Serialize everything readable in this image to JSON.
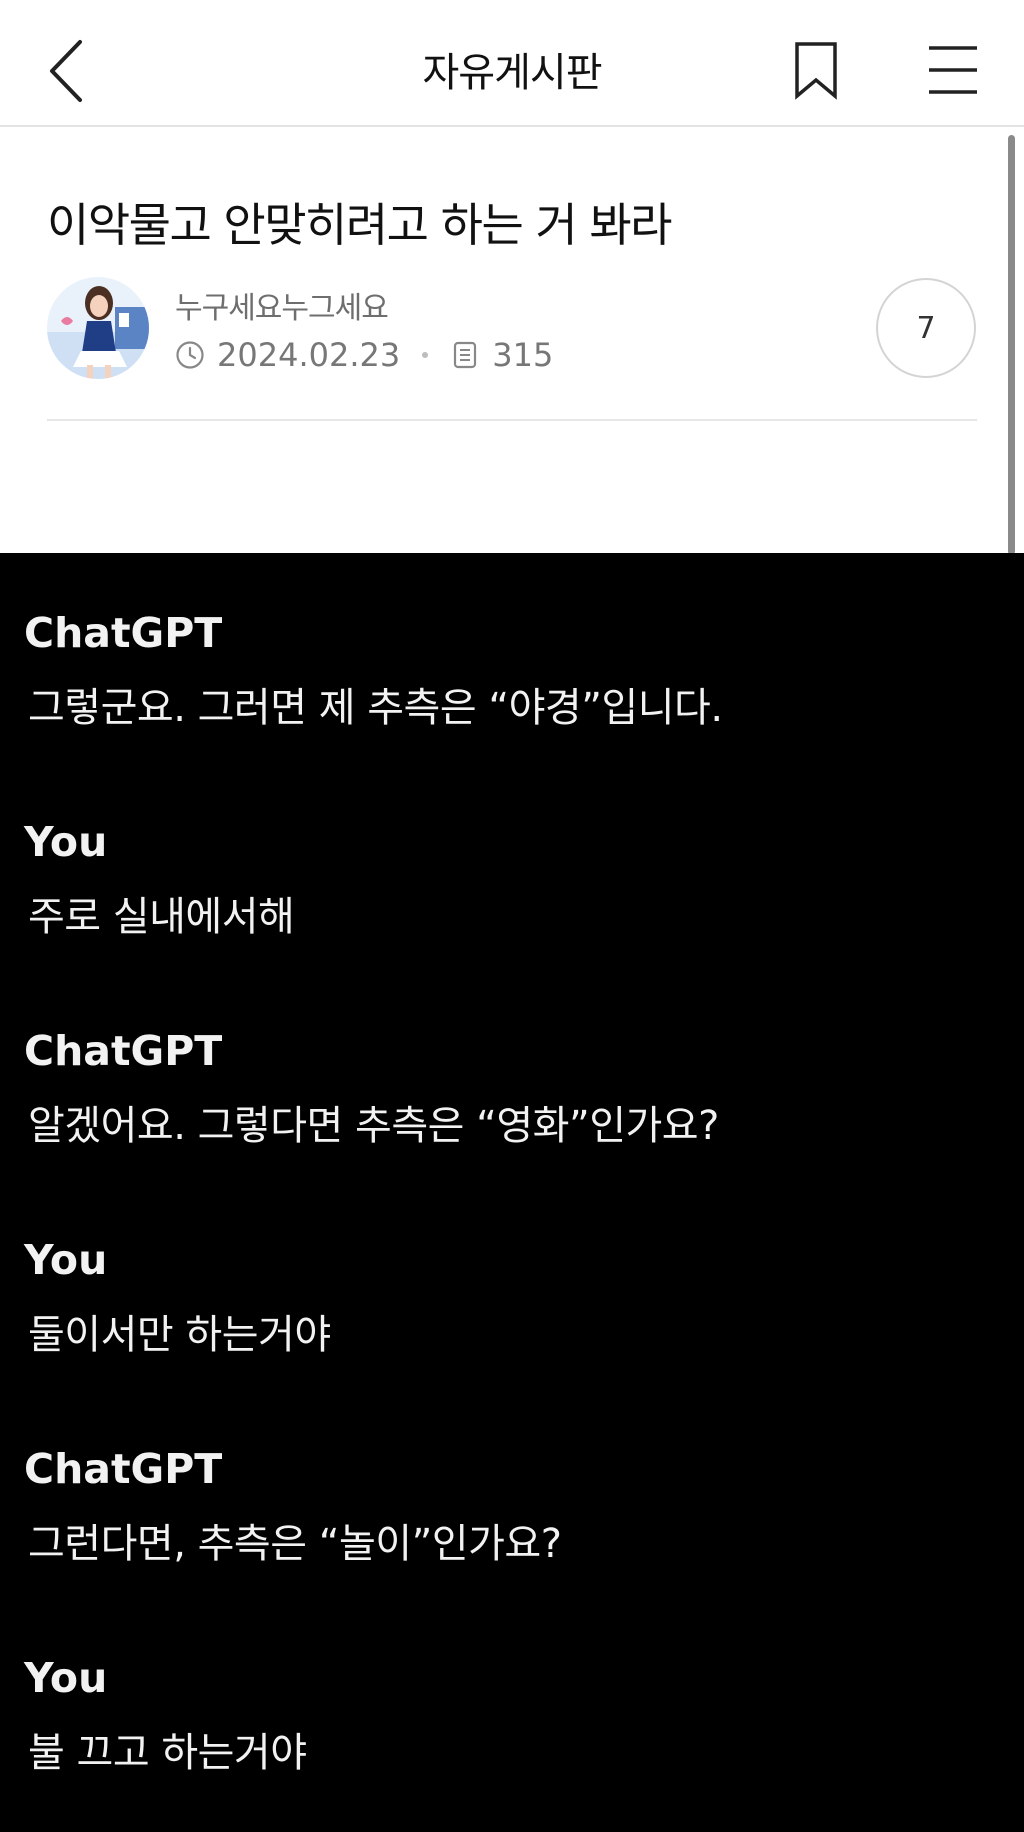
{
  "header": {
    "title": "자유게시판",
    "back_icon": "chevron-left-icon",
    "bookmark_icon": "bookmark-icon",
    "menu_icon": "hamburger-menu-icon"
  },
  "post": {
    "title": "이악물고 안맞히려고 하는 거 봐라",
    "author": "누구세요누그세요",
    "date": "2024.02.23",
    "views": "315",
    "comment_count": "7",
    "clock_icon": "clock-icon",
    "views_icon": "document-icon"
  },
  "chat": {
    "messages": [
      {
        "speaker": "ChatGPT",
        "text": "그렇군요. 그러면 제 추측은 “야경”입니다."
      },
      {
        "speaker": "You",
        "text": "주로 실내에서해"
      },
      {
        "speaker": "ChatGPT",
        "text": "알겠어요. 그렇다면 추측은 “영화”인가요?"
      },
      {
        "speaker": "You",
        "text": "둘이서만 하는거야"
      },
      {
        "speaker": "ChatGPT",
        "text": "그런다면, 추측은 “놀이”인가요?"
      },
      {
        "speaker": "You",
        "text": "불 끄고 하는거야"
      }
    ]
  },
  "colors": {
    "chat_background": "#000000",
    "chat_text": "#f2f2f2",
    "meta_text": "#777777"
  }
}
